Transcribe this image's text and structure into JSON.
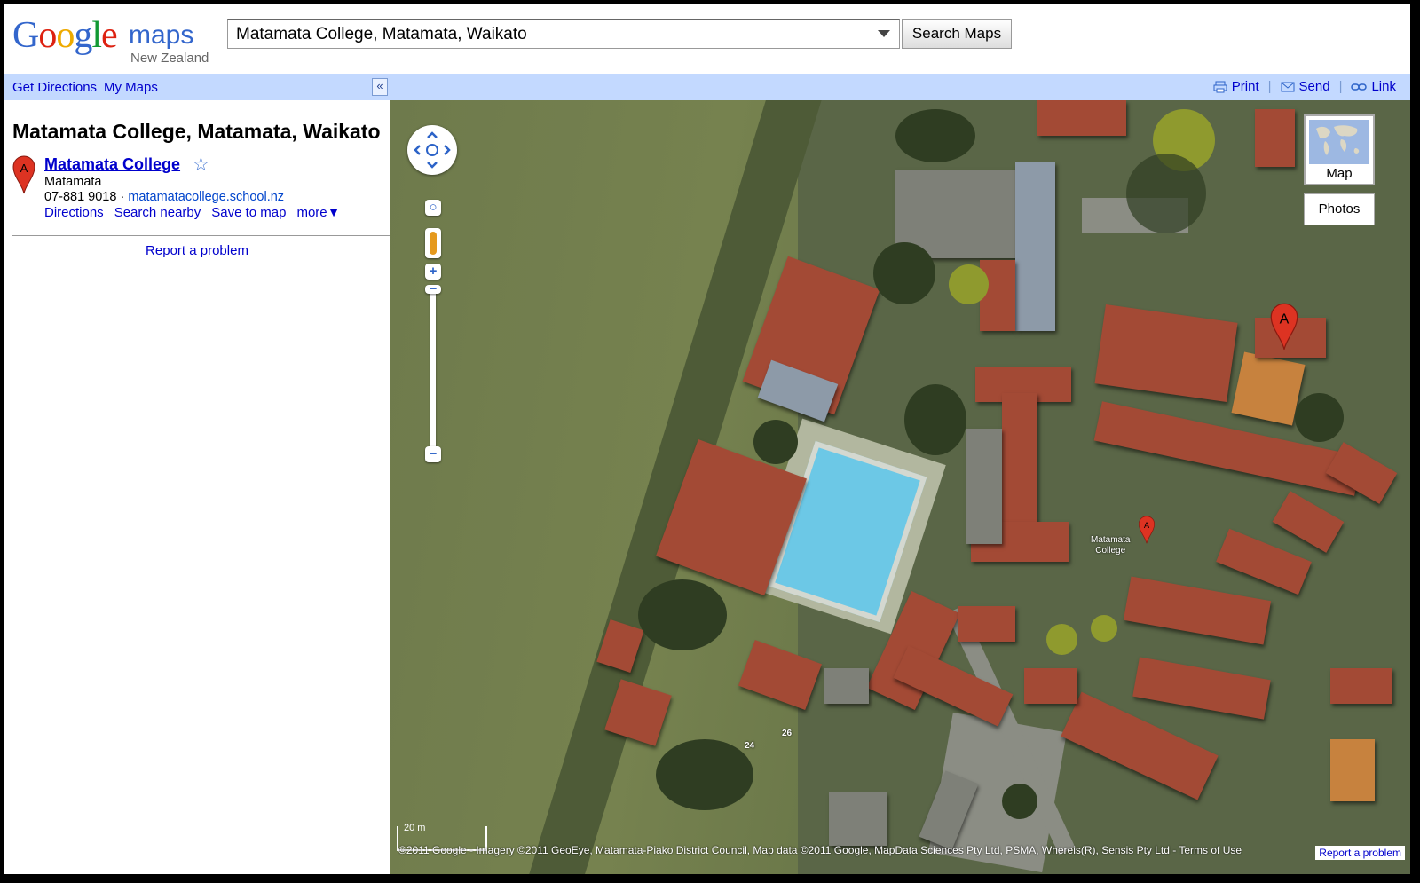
{
  "header": {
    "logo_text": "Google",
    "logo_maps": "maps",
    "logo_region": "New Zealand",
    "search_value": "Matamata College, Matamata, Waikato",
    "search_button": "Search Maps"
  },
  "toolbar": {
    "get_directions": "Get Directions",
    "my_maps": "My Maps",
    "collapse": "«",
    "print": "Print",
    "send": "Send",
    "link": "Link"
  },
  "panel": {
    "title": "Matamata College, Matamata, Waikato",
    "result": {
      "marker": "A",
      "name": "Matamata College",
      "locality": "Matamata",
      "phone": "07-881 9018",
      "separator": "·",
      "website": "matamatacollege.school.nz",
      "actions": [
        "Directions",
        "Search nearby",
        "Save to map",
        "more▼"
      ]
    },
    "report_problem": "Report a problem"
  },
  "map": {
    "map_type_label": "Map",
    "photos_label": "Photos",
    "marker_big": "A",
    "marker_small": "A",
    "marker_label_line1": "Matamata",
    "marker_label_line2": "College",
    "scale_label": "20 m",
    "house_numbers": [
      "24",
      "26"
    ],
    "copyright": "©2011 Google - Imagery ©2011 GeoEye, Matamata-Piako District Council, Map data ©2011 Google, MapData Sciences Pty Ltd, PSMA, Whereis(R), Sensis Pty Ltd - Terms of Use",
    "report_problem": "Report a problem"
  },
  "colors": {
    "toolbar_bg": "#c3d9ff",
    "link": "#0000cc",
    "marker": "#dd3322",
    "star": "#4a7bd5"
  }
}
